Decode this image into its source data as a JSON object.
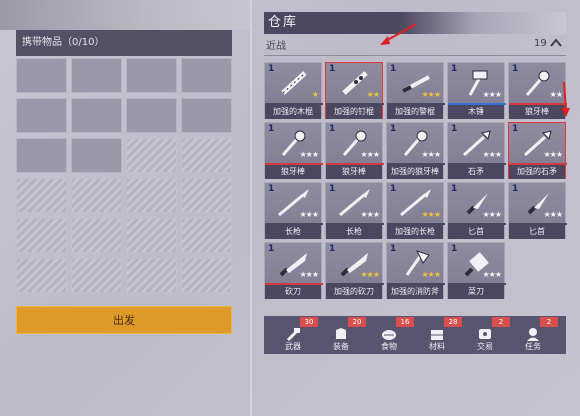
{
  "carry": {
    "title": "携带物品（0/10）",
    "open_slots": 10,
    "locked_slots": 14,
    "depart_label": "出发"
  },
  "warehouse": {
    "title": "仓库",
    "category": "近战",
    "count": "19",
    "items": [
      {
        "count": "1",
        "name": "加强的木棍",
        "stars": 1,
        "star_color": "gold",
        "bar": "#4b4760",
        "icon": "club-icon",
        "selected": false
      },
      {
        "count": "1",
        "name": "加强的钉棍",
        "stars": 2,
        "star_color": "gold",
        "bar": "#4b4760",
        "icon": "spiked-club-icon",
        "selected": true
      },
      {
        "count": "1",
        "name": "加强的警棍",
        "stars": 3,
        "star_color": "gold",
        "bar": "#4b4760",
        "icon": "baton-icon",
        "selected": false
      },
      {
        "count": "1",
        "name": "木锤",
        "stars": 3,
        "star_color": "white",
        "bar": "#3b6fd6",
        "icon": "hammer-icon",
        "selected": false
      },
      {
        "count": "1",
        "name": "狼牙棒",
        "stars": 2,
        "star_color": "white",
        "bar": "#d23b3b",
        "icon": "mace-icon",
        "selected": false
      },
      {
        "count": "1",
        "name": "狼牙棒",
        "stars": 3,
        "star_color": "white",
        "bar": "#d23b3b",
        "icon": "mace-icon",
        "selected": false
      },
      {
        "count": "1",
        "name": "狼牙棒",
        "stars": 3,
        "star_color": "white",
        "bar": "#d23b3b",
        "icon": "mace-icon",
        "selected": false
      },
      {
        "count": "1",
        "name": "加强的狼牙棒",
        "stars": 3,
        "star_color": "white",
        "bar": "#4b4760",
        "icon": "mace-icon",
        "selected": false
      },
      {
        "count": "1",
        "name": "石矛",
        "stars": 3,
        "star_color": "white",
        "bar": "#4b4760",
        "icon": "stone-spear-icon",
        "selected": false
      },
      {
        "count": "1",
        "name": "加强的石矛",
        "stars": 3,
        "star_color": "white",
        "bar": "#d23b3b",
        "icon": "stone-spear-icon",
        "selected": true
      },
      {
        "count": "1",
        "name": "长枪",
        "stars": 3,
        "star_color": "white",
        "bar": "#4b4760",
        "icon": "spear-icon",
        "selected": false
      },
      {
        "count": "1",
        "name": "长枪",
        "stars": 3,
        "star_color": "white",
        "bar": "#4b4760",
        "icon": "spear-icon",
        "selected": false
      },
      {
        "count": "1",
        "name": "加强的长枪",
        "stars": 3,
        "star_color": "gold",
        "bar": "#4b4760",
        "icon": "spear-icon",
        "selected": false
      },
      {
        "count": "1",
        "name": "匕首",
        "stars": 3,
        "star_color": "white",
        "bar": "#4b4760",
        "icon": "dagger-icon",
        "selected": false
      },
      {
        "count": "1",
        "name": "匕首",
        "stars": 3,
        "star_color": "white",
        "bar": "#4b4760",
        "icon": "dagger-icon",
        "selected": false
      },
      {
        "count": "1",
        "name": "砍刀",
        "stars": 3,
        "star_color": "white",
        "bar": "#d23b3b",
        "icon": "machete-icon",
        "selected": false
      },
      {
        "count": "1",
        "name": "加强的砍刀",
        "stars": 3,
        "star_color": "gold",
        "bar": "#4b4760",
        "icon": "machete-icon",
        "selected": false
      },
      {
        "count": "1",
        "name": "加强的消防斧",
        "stars": 3,
        "star_color": "gold",
        "bar": "#4b4760",
        "icon": "fire-axe-icon",
        "selected": false
      },
      {
        "count": "1",
        "name": "菜刀",
        "stars": 3,
        "star_color": "white",
        "bar": "#4b4760",
        "icon": "cleaver-icon",
        "selected": false
      }
    ]
  },
  "tabs": [
    {
      "label": "武器",
      "badge": "30",
      "icon": "weapon-icon"
    },
    {
      "label": "装备",
      "badge": "20",
      "icon": "armor-icon"
    },
    {
      "label": "食物",
      "badge": "16",
      "icon": "food-icon"
    },
    {
      "label": "材料",
      "badge": "28",
      "icon": "material-icon"
    },
    {
      "label": "交易",
      "badge": "2",
      "icon": "trade-icon"
    },
    {
      "label": "任务",
      "badge": "2",
      "icon": "quest-icon"
    }
  ]
}
